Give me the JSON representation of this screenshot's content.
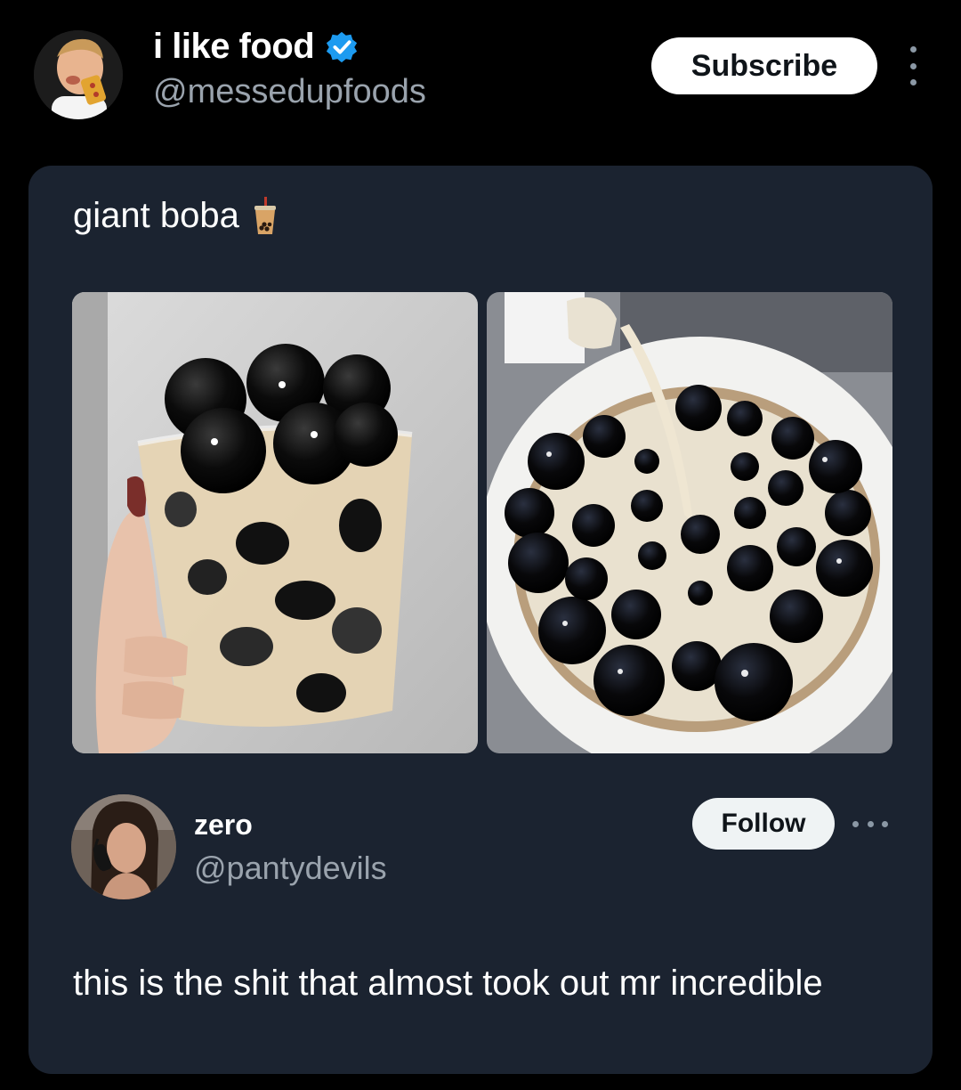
{
  "author": {
    "name": "i like food",
    "handle": "@messedupfoods",
    "verified": true
  },
  "actions": {
    "subscribe_label": "Subscribe"
  },
  "post": {
    "text": "giant boba",
    "emoji": "bubble-tea",
    "media": [
      {
        "description_icon": "photo-icon"
      },
      {
        "description_icon": "photo-icon"
      }
    ]
  },
  "quoted": {
    "name": "zero",
    "handle": "@pantydevils",
    "follow_label": "Follow",
    "text": "this is the shit that almost took out mr incredible"
  },
  "colors": {
    "background": "#000000",
    "card": "#1b2330",
    "verified_blue": "#1d9bf0",
    "secondary_text": "#9aa3ad"
  }
}
